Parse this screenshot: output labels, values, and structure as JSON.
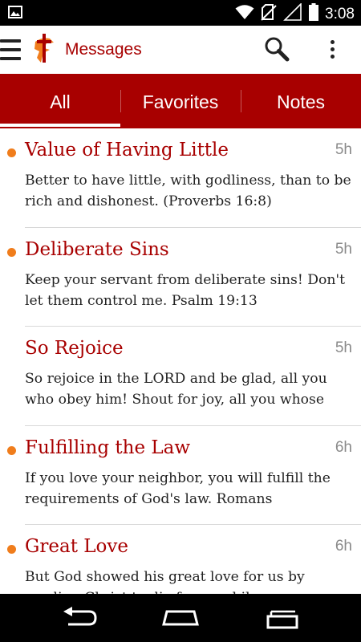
{
  "status_bar": {
    "time": "3:08",
    "icons": [
      "gallery-notification-icon",
      "wifi-icon",
      "no-sim-icon",
      "signal-icon",
      "battery-icon"
    ]
  },
  "action_bar": {
    "title": "Messages",
    "logo": "dove-cross-logo",
    "actions": [
      "menu-icon",
      "search-icon",
      "overflow-menu-icon"
    ]
  },
  "tabs": [
    {
      "label": "All",
      "active": true
    },
    {
      "label": "Favorites",
      "active": false
    },
    {
      "label": "Notes",
      "active": false
    }
  ],
  "messages": [
    {
      "title": "Value of Having Little",
      "time": "5h",
      "unread": true,
      "body": "Better to have little, with godliness, than to be rich and dishonest. (Proverbs 16:8)"
    },
    {
      "title": "Deliberate Sins",
      "time": "5h",
      "unread": true,
      "body": "Keep your servant from deliberate sins! Don't let them control me. Psalm 19:13"
    },
    {
      "title": "So Rejoice",
      "time": "5h",
      "unread": false,
      "body": "So rejoice in the LORD and be glad, all you who obey him! Shout for joy, all you whose"
    },
    {
      "title": "Fulfilling the Law",
      "time": "6h",
      "unread": true,
      "body": "If you love your neighbor, you will fulfill the requirements of God's law. Romans"
    },
    {
      "title": "Great Love",
      "time": "6h",
      "unread": true,
      "body": "But God showed his great love for us by sending Christ to die for us while"
    }
  ],
  "nav_bar": [
    "back-icon",
    "home-icon",
    "recent-apps-icon"
  ],
  "colors": {
    "brand": "#a80000",
    "unread_dot": "#f07d1c",
    "time_text": "#8a8a8a"
  }
}
